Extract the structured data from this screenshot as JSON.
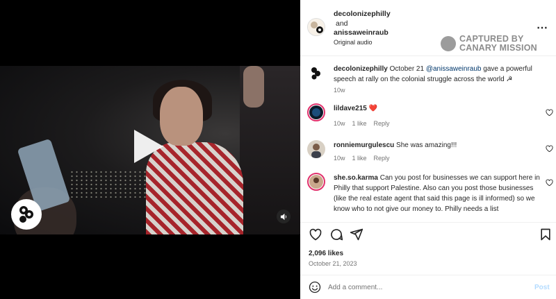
{
  "header": {
    "user1": "decolonizephilly",
    "and": "and",
    "user2": "anissaweinraub",
    "audio": "Original audio"
  },
  "watermark": {
    "line1": "CAPTURED BY",
    "line2": "CANARY MISSION"
  },
  "caption": {
    "username": "decolonizephilly",
    "date_prefix": "October 21",
    "mention": "@anissaweinraub",
    "text": "gave a powerful speech at rally on the colonial struggle across the world",
    "trailing": "☭",
    "time": "10w"
  },
  "comments": [
    {
      "username": "lildave215",
      "text": "",
      "emoji": "❤️",
      "time": "10w",
      "likes": "1 like",
      "reply": "Reply"
    },
    {
      "username": "ronniemurgulescu",
      "text": "She was amazing!!!",
      "time": "10w",
      "likes": "1 like",
      "reply": "Reply"
    },
    {
      "username": "she.so.karma",
      "text": "Can you post for businesses we can support here in Philly that support Palestine. Also can you post those businesses (like the real estate agent that said this page is ill informed) so we know who to not give our money to. Philly needs a list"
    }
  ],
  "stats": {
    "likes": "2,096 likes",
    "date": "October 21, 2023"
  },
  "add_comment": {
    "placeholder": "Add a comment...",
    "post_label": "Post"
  },
  "colors": {
    "accent_link": "#00376b",
    "post_disabled": "#b3dbff",
    "story_ring": "#e1306c",
    "heart": "#ed4956"
  }
}
